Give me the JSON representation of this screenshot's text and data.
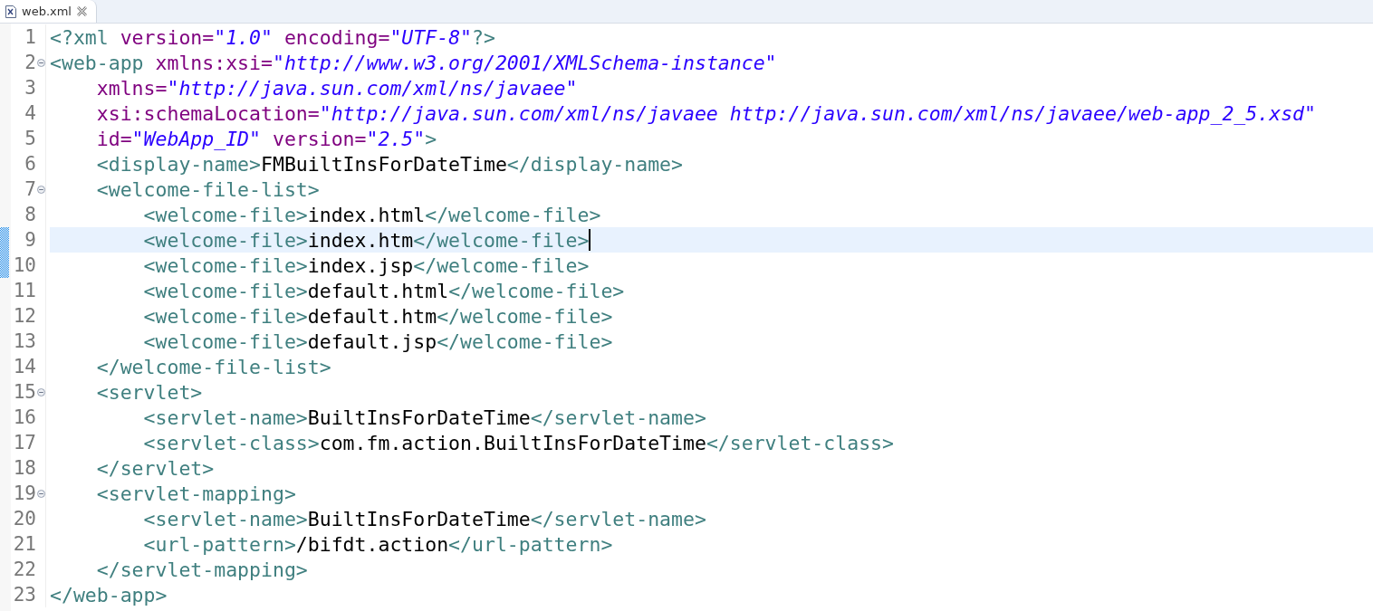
{
  "tabs": [
    {
      "label": "web.xml",
      "selected": true
    }
  ],
  "editor": {
    "lines": [
      {
        "number": "1",
        "fold": false,
        "current": false,
        "changed": false,
        "tokens": [
          {
            "kind": "tag",
            "text": "<?xml"
          },
          {
            "kind": "attr",
            "text": " version="
          },
          {
            "kind": "value",
            "text": "\"1.0\""
          },
          {
            "kind": "attr",
            "text": " encoding="
          },
          {
            "kind": "value",
            "text": "\"UTF-8\""
          },
          {
            "kind": "tag",
            "text": "?>"
          }
        ]
      },
      {
        "number": "2",
        "fold": true,
        "current": false,
        "changed": false,
        "tokens": [
          {
            "kind": "tag",
            "text": "<web-app"
          },
          {
            "kind": "attr",
            "text": " xmlns:xsi="
          },
          {
            "kind": "value",
            "text": "\"http://www.w3.org/2001/XMLSchema-instance\""
          }
        ]
      },
      {
        "number": "3",
        "fold": false,
        "current": false,
        "changed": false,
        "tokens": [
          {
            "kind": "attr",
            "text": "    xmlns="
          },
          {
            "kind": "value",
            "text": "\"http://java.sun.com/xml/ns/javaee\""
          }
        ]
      },
      {
        "number": "4",
        "fold": false,
        "current": false,
        "changed": false,
        "tokens": [
          {
            "kind": "attr",
            "text": "    xsi:schemaLocation="
          },
          {
            "kind": "value",
            "text": "\"http://java.sun.com/xml/ns/javaee http://java.sun.com/xml/ns/javaee/web-app_2_5.xsd\""
          }
        ]
      },
      {
        "number": "5",
        "fold": false,
        "current": false,
        "changed": false,
        "tokens": [
          {
            "kind": "attr",
            "text": "    id="
          },
          {
            "kind": "value",
            "text": "\"WebApp_ID\""
          },
          {
            "kind": "attr",
            "text": " version="
          },
          {
            "kind": "value",
            "text": "\"2.5\""
          },
          {
            "kind": "tag",
            "text": ">"
          }
        ]
      },
      {
        "number": "6",
        "fold": false,
        "current": false,
        "changed": false,
        "tokens": [
          {
            "kind": "tag",
            "text": "    <display-name>"
          },
          {
            "kind": "text",
            "text": "FMBuiltInsForDateTime"
          },
          {
            "kind": "tag",
            "text": "</display-name>"
          }
        ]
      },
      {
        "number": "7",
        "fold": true,
        "current": false,
        "changed": false,
        "tokens": [
          {
            "kind": "tag",
            "text": "    <welcome-file-list>"
          }
        ]
      },
      {
        "number": "8",
        "fold": false,
        "current": false,
        "changed": false,
        "tokens": [
          {
            "kind": "tag",
            "text": "        <welcome-file>"
          },
          {
            "kind": "text",
            "text": "index.html"
          },
          {
            "kind": "tag",
            "text": "</welcome-file>"
          }
        ]
      },
      {
        "number": "9",
        "fold": false,
        "current": true,
        "changed": true,
        "tokens": [
          {
            "kind": "tag",
            "text": "        <welcome-file>"
          },
          {
            "kind": "text",
            "text": "index.htm"
          },
          {
            "kind": "tag",
            "text": "</welcome-file>"
          }
        ]
      },
      {
        "number": "10",
        "fold": false,
        "current": false,
        "changed": true,
        "tokens": [
          {
            "kind": "tag",
            "text": "        <welcome-file>"
          },
          {
            "kind": "text",
            "text": "index.jsp"
          },
          {
            "kind": "tag",
            "text": "</welcome-file>"
          }
        ]
      },
      {
        "number": "11",
        "fold": false,
        "current": false,
        "changed": false,
        "tokens": [
          {
            "kind": "tag",
            "text": "        <welcome-file>"
          },
          {
            "kind": "text",
            "text": "default.html"
          },
          {
            "kind": "tag",
            "text": "</welcome-file>"
          }
        ]
      },
      {
        "number": "12",
        "fold": false,
        "current": false,
        "changed": false,
        "tokens": [
          {
            "kind": "tag",
            "text": "        <welcome-file>"
          },
          {
            "kind": "text",
            "text": "default.htm"
          },
          {
            "kind": "tag",
            "text": "</welcome-file>"
          }
        ]
      },
      {
        "number": "13",
        "fold": false,
        "current": false,
        "changed": false,
        "tokens": [
          {
            "kind": "tag",
            "text": "        <welcome-file>"
          },
          {
            "kind": "text",
            "text": "default.jsp"
          },
          {
            "kind": "tag",
            "text": "</welcome-file>"
          }
        ]
      },
      {
        "number": "14",
        "fold": false,
        "current": false,
        "changed": false,
        "tokens": [
          {
            "kind": "tag",
            "text": "    </welcome-file-list>"
          }
        ]
      },
      {
        "number": "15",
        "fold": true,
        "current": false,
        "changed": false,
        "tokens": [
          {
            "kind": "tag",
            "text": "    <servlet>"
          }
        ]
      },
      {
        "number": "16",
        "fold": false,
        "current": false,
        "changed": false,
        "tokens": [
          {
            "kind": "tag",
            "text": "        <servlet-name>"
          },
          {
            "kind": "text",
            "text": "BuiltInsForDateTime"
          },
          {
            "kind": "tag",
            "text": "</servlet-name>"
          }
        ]
      },
      {
        "number": "17",
        "fold": false,
        "current": false,
        "changed": false,
        "tokens": [
          {
            "kind": "tag",
            "text": "        <servlet-class>"
          },
          {
            "kind": "text",
            "text": "com.fm.action.BuiltInsForDateTime"
          },
          {
            "kind": "tag",
            "text": "</servlet-class>"
          }
        ]
      },
      {
        "number": "18",
        "fold": false,
        "current": false,
        "changed": false,
        "tokens": [
          {
            "kind": "tag",
            "text": "    </servlet>"
          }
        ]
      },
      {
        "number": "19",
        "fold": true,
        "current": false,
        "changed": false,
        "tokens": [
          {
            "kind": "tag",
            "text": "    <servlet-mapping>"
          }
        ]
      },
      {
        "number": "20",
        "fold": false,
        "current": false,
        "changed": false,
        "tokens": [
          {
            "kind": "tag",
            "text": "        <servlet-name>"
          },
          {
            "kind": "text",
            "text": "BuiltInsForDateTime"
          },
          {
            "kind": "tag",
            "text": "</servlet-name>"
          }
        ]
      },
      {
        "number": "21",
        "fold": false,
        "current": false,
        "changed": false,
        "tokens": [
          {
            "kind": "tag",
            "text": "        <url-pattern>"
          },
          {
            "kind": "text",
            "text": "/bifdt.action"
          },
          {
            "kind": "tag",
            "text": "</url-pattern>"
          }
        ]
      },
      {
        "number": "22",
        "fold": false,
        "current": false,
        "changed": false,
        "tokens": [
          {
            "kind": "tag",
            "text": "    </servlet-mapping>"
          }
        ]
      },
      {
        "number": "23",
        "fold": false,
        "current": false,
        "changed": false,
        "tokens": [
          {
            "kind": "tag",
            "text": "</web-app>"
          }
        ]
      }
    ]
  }
}
